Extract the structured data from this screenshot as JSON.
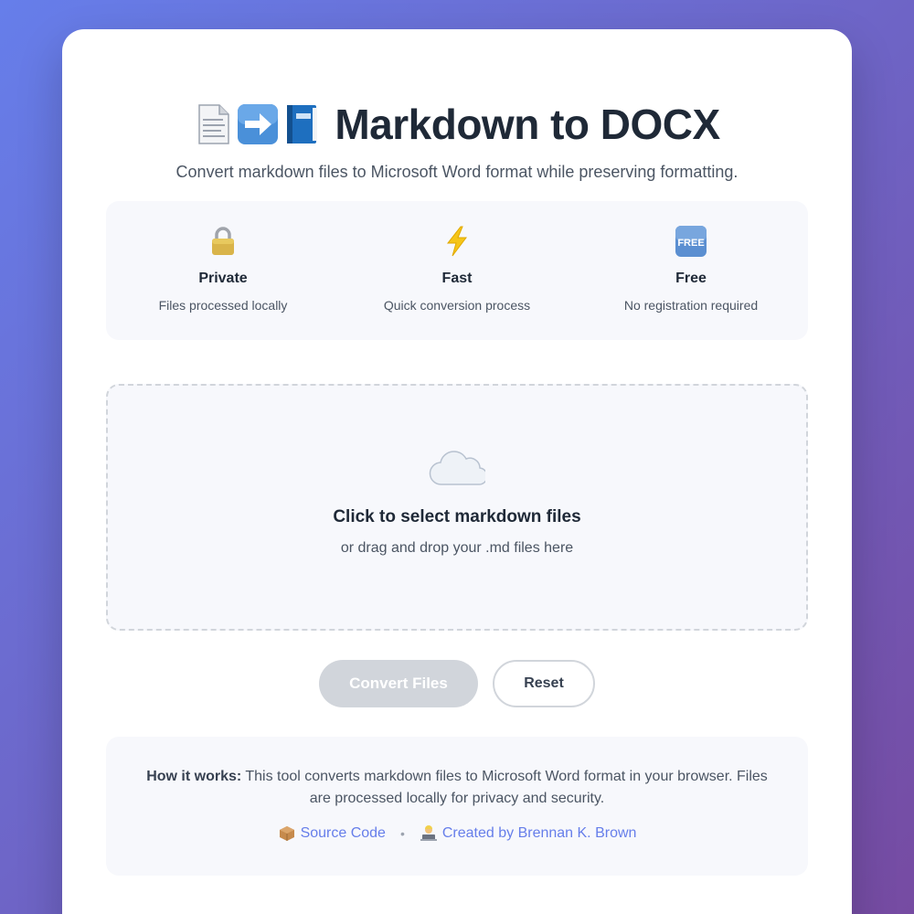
{
  "header": {
    "title": "Markdown to DOCX",
    "title_icons": [
      "page-icon",
      "right-arrow-icon",
      "blue-book-icon"
    ],
    "subtitle": "Convert markdown files to Microsoft Word format while preserving formatting."
  },
  "features": [
    {
      "icon": "lock-icon",
      "title": "Private",
      "desc": "Files processed locally"
    },
    {
      "icon": "lightning-icon",
      "title": "Fast",
      "desc": "Quick conversion process"
    },
    {
      "icon": "free-icon",
      "icon_text": "FREE",
      "title": "Free",
      "desc": "No registration required"
    }
  ],
  "dropzone": {
    "icon": "cloud-icon",
    "title": "Click to select markdown files",
    "subtitle": "or drag and drop your .md files here"
  },
  "actions": {
    "convert_label": "Convert Files",
    "reset_label": "Reset"
  },
  "info": {
    "heading": "How it works:",
    "text": " This tool converts markdown files to Microsoft Word format in your browser. Files are processed locally for privacy and security.",
    "source_link": "Source Code",
    "separator": "•",
    "author_link": "Created by Brennan K. Brown"
  },
  "colors": {
    "gradient_start": "#667eea",
    "gradient_end": "#764ba2",
    "link": "#667eea",
    "button_disabled": "#d1d5db"
  }
}
